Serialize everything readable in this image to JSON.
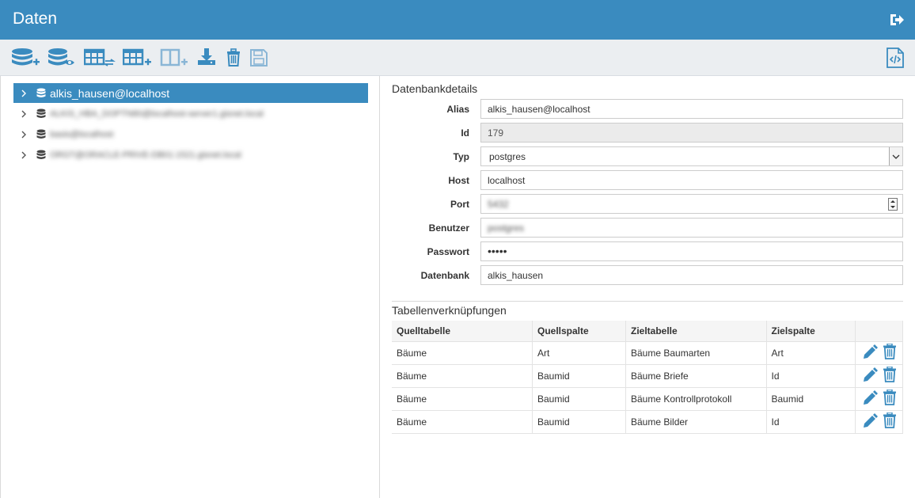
{
  "header": {
    "title": "Daten",
    "logout_icon": "sign-out-icon"
  },
  "toolbar": {
    "buttons": [
      {
        "name": "add-database-button",
        "icon": "database-plus-icon"
      },
      {
        "name": "view-database-button",
        "icon": "database-eye-icon"
      },
      {
        "name": "table-link-button",
        "icon": "table-arrows-icon"
      },
      {
        "name": "add-table-button",
        "icon": "table-plus-icon"
      },
      {
        "name": "add-column-button",
        "icon": "columns-plus-icon"
      },
      {
        "name": "import-button",
        "icon": "download-icon"
      },
      {
        "name": "delete-button",
        "icon": "trash-icon"
      },
      {
        "name": "save-button",
        "icon": "save-icon"
      },
      {
        "name": "code-button",
        "icon": "code-file-icon"
      }
    ]
  },
  "tree": {
    "items": [
      {
        "label": "alkis_hausen@localhost",
        "selected": true
      },
      {
        "label": "ALKIS_HBA_DOPTN80@localhost-server1.gisnet.local",
        "blurred": true
      },
      {
        "label": "basis@localhost",
        "blurred": true
      },
      {
        "label": "ORGT@ORACLE-PRIVE-DB01:1521.gisnet.local",
        "blurred": true
      }
    ]
  },
  "details": {
    "title": "Datenbankdetails",
    "alias": {
      "label": "Alias",
      "value": "alkis_hausen@localhost"
    },
    "id": {
      "label": "Id",
      "value": "179"
    },
    "typ": {
      "label": "Typ",
      "value": "postgres"
    },
    "host": {
      "label": "Host",
      "value": "localhost"
    },
    "port": {
      "label": "Port",
      "value": "5432"
    },
    "benutzer": {
      "label": "Benutzer",
      "value": "postgres"
    },
    "passwort": {
      "label": "Passwort",
      "value": "•••••"
    },
    "datenbank": {
      "label": "Datenbank",
      "value": "alkis_hausen"
    }
  },
  "links": {
    "title": "Tabellenverknüpfungen",
    "headers": [
      "Quelltabelle",
      "Quellspalte",
      "Zieltabelle",
      "Zielspalte"
    ],
    "rows": [
      [
        "Bäume",
        "Art",
        "Bäume Baumarten",
        "Art"
      ],
      [
        "Bäume",
        "Baumid",
        "Bäume Briefe",
        "Id"
      ],
      [
        "Bäume",
        "Baumid",
        "Bäume Kontrollprotokoll",
        "Baumid"
      ],
      [
        "Bäume",
        "Baumid",
        "Bäume Bilder",
        "Id"
      ]
    ],
    "row_actions": [
      "pencil-icon",
      "trash-icon"
    ]
  },
  "colors": {
    "accent": "#3a8bbf",
    "toolbar_bg": "#ebeef1"
  }
}
